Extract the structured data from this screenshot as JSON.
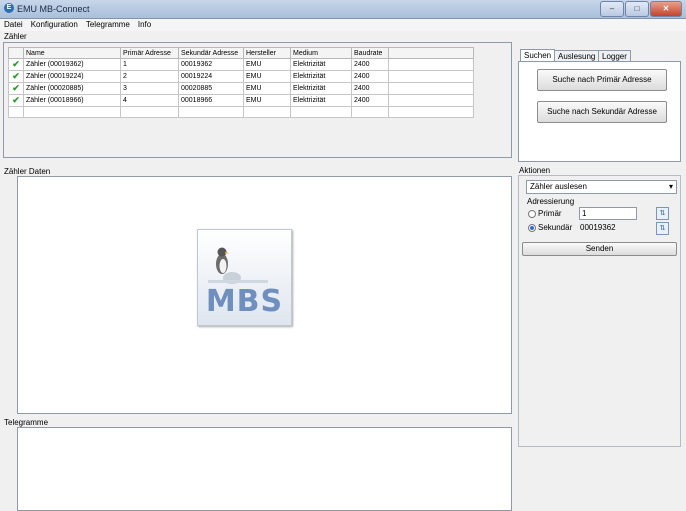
{
  "window": {
    "title": "EMU MB-Connect"
  },
  "menu": [
    "Datei",
    "Konfiguration",
    "Telegramme",
    "Info"
  ],
  "meters": {
    "group_label": "Zähler",
    "columns": [
      "Name",
      "Primär Adresse",
      "Sekundär Adresse",
      "Hersteller",
      "Medium",
      "Baudrate"
    ],
    "rows": [
      [
        "Zähler (00019362)",
        "1",
        "00019362",
        "EMU",
        "Elektrizität",
        "2400"
      ],
      [
        "Zähler (00019224)",
        "2",
        "00019224",
        "EMU",
        "Elektrizität",
        "2400"
      ],
      [
        "Zähler (00020885)",
        "3",
        "00020885",
        "EMU",
        "Elektrizität",
        "2400"
      ],
      [
        "Zähler (00018966)",
        "4",
        "00018966",
        "EMU",
        "Elektrizität",
        "2400"
      ]
    ]
  },
  "tabs": [
    "Suchen",
    "Auslesung",
    "Logger"
  ],
  "search": {
    "primary_button": "Suche nach Primär Adresse",
    "secondary_button": "Suche nach Sekundär Adresse"
  },
  "meter_data": {
    "label": "Zähler Daten",
    "logo_text": "MBS"
  },
  "actions": {
    "label": "Aktionen",
    "action_select": "Zähler auslesen",
    "addressing_label": "Adressierung",
    "primary_label": "Primär",
    "primary_value": "1",
    "secondary_label": "Sekundär",
    "secondary_value": "00019362",
    "selected_mode": "secondary",
    "send_button": "Senden"
  },
  "telegrams": {
    "label": "Telegramme"
  }
}
